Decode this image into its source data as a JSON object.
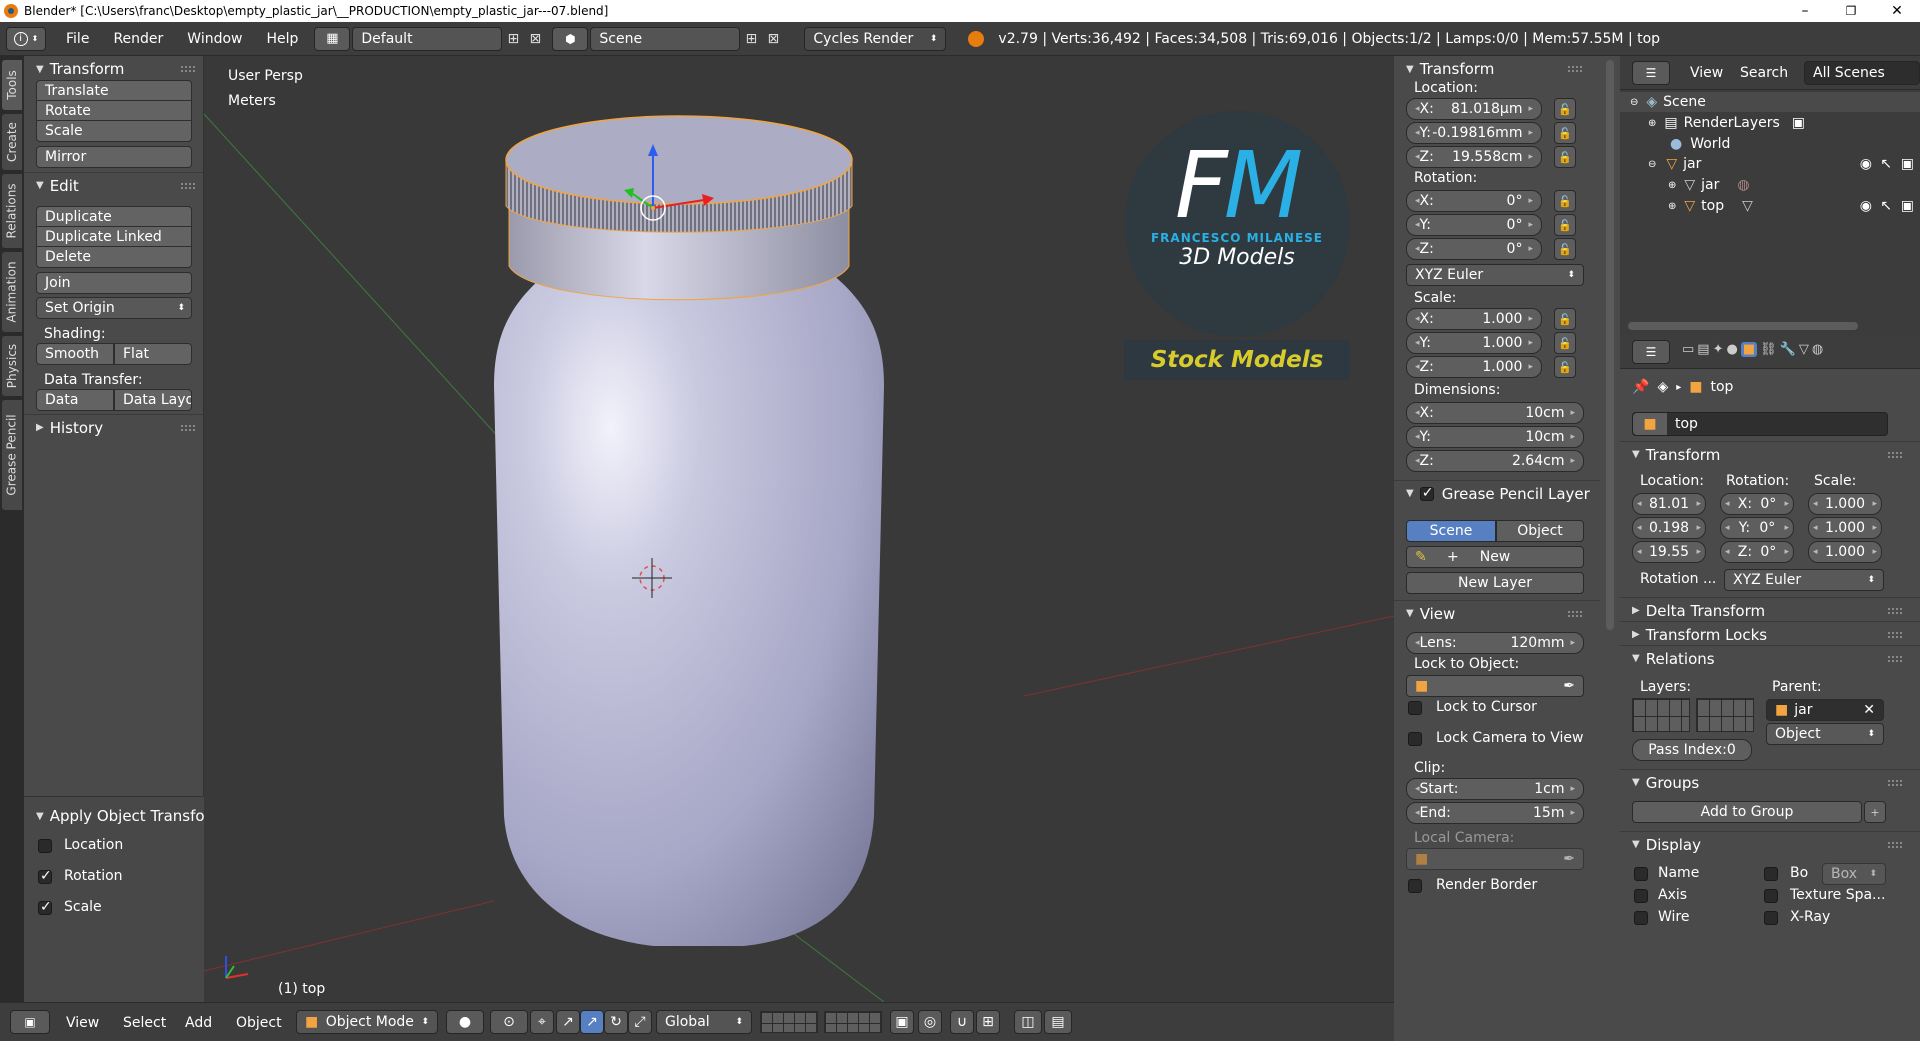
{
  "window": {
    "title": "Blender* [C:\\Users\\franc\\Desktop\\empty_plastic_jar\\__PRODUCTION\\empty_plastic_jar---07.blend]",
    "minimize": "–",
    "maximize": "❐",
    "close": "✕"
  },
  "menubar": {
    "info_icon": "i",
    "items": [
      "File",
      "Render",
      "Window",
      "Help"
    ],
    "screen_layout": "Default",
    "scene": "Scene",
    "render_engine": "Cycles Render",
    "stats": "v2.79 | Verts:36,492 | Faces:34,508 | Tris:69,016 | Objects:1/2 | Lamps:0/0 | Mem:57.55M | top"
  },
  "left_tabs": [
    "Tools",
    "Create",
    "Relations",
    "Animation",
    "Physics",
    "Grease Pencil"
  ],
  "toolshelf": {
    "transform": {
      "title": "Transform",
      "buttons": [
        "Translate",
        "Rotate",
        "Scale"
      ],
      "mirror": "Mirror"
    },
    "edit": {
      "title": "Edit",
      "buttons": [
        "Duplicate",
        "Duplicate Linked",
        "Delete"
      ],
      "join": "Join",
      "set_origin": "Set Origin",
      "shading_label": "Shading:",
      "smooth": "Smooth",
      "flat": "Flat",
      "data_transfer_label": "Data Transfer:",
      "data": "Data",
      "data_layout": "Data Layo"
    },
    "history": "History",
    "operator": {
      "title": "Apply Object Transform",
      "location": "Location",
      "location_checked": false,
      "rotation": "Rotation",
      "rotation_checked": true,
      "scale": "Scale",
      "scale_checked": true
    }
  },
  "viewport": {
    "view_name": "User Persp",
    "units": "Meters",
    "active_object": "(1) top",
    "logo": {
      "letters": "FM",
      "name": "FRANCESCO MILANESE",
      "sub": "3D Models",
      "badge": "Stock Models"
    }
  },
  "npanel": {
    "transform_title": "Transform",
    "location_label": "Location:",
    "location": {
      "x": "X:",
      "x_val": "81.018µm",
      "y": "Y:",
      "y_val": "-0.19816mm",
      "z": "Z:",
      "z_val": "19.558cm"
    },
    "rotation_label": "Rotation:",
    "rotation": {
      "x": "X:",
      "x_val": "0°",
      "y": "Y:",
      "y_val": "0°",
      "z": "Z:",
      "z_val": "0°"
    },
    "rotation_mode": "XYZ Euler",
    "scale_label": "Scale:",
    "scale": {
      "x": "X:",
      "x_val": "1.000",
      "y": "Y:",
      "y_val": "1.000",
      "z": "Z:",
      "z_val": "1.000"
    },
    "dimensions_label": "Dimensions:",
    "dimensions": {
      "x": "X:",
      "x_val": "10cm",
      "y": "Y:",
      "y_val": "10cm",
      "z": "Z:",
      "z_val": "2.64cm"
    },
    "grease_title": "Grease Pencil Layer",
    "scene_btn": "Scene",
    "object_btn": "Object",
    "new_btn": "New",
    "new_layer_btn": "New Layer",
    "view_title": "View",
    "lens_label": "Lens:",
    "lens_val": "120mm",
    "lock_object_label": "Lock to Object:",
    "lock_cursor": "Lock to Cursor",
    "lock_camera": "Lock Camera to View",
    "clip_label": "Clip:",
    "clip_start_label": "Start:",
    "clip_start": "1cm",
    "clip_end_label": "End:",
    "clip_end": "15m",
    "local_camera_label": "Local Camera:",
    "render_border": "Render Border"
  },
  "outliner": {
    "view": "View",
    "search": "Search",
    "filter": "All Scenes",
    "items": {
      "scene": "Scene",
      "renderlayers": "RenderLayers",
      "world": "World",
      "jar": "jar",
      "jar_mesh": "jar",
      "top": "top"
    }
  },
  "properties": {
    "breadcrumb": "top",
    "object_name": "top",
    "transform_title": "Transform",
    "location_label": "Location:",
    "rotation_label": "Rotation:",
    "scale_label": "Scale:",
    "loc": [
      "81.01",
      "0.198",
      "19.55"
    ],
    "rot_x": "X:",
    "rot_y": "Y:",
    "rot_z": "Z:",
    "rot": [
      "0°",
      "0°",
      "0°"
    ],
    "scale": [
      "1.000",
      "1.000",
      "1.000"
    ],
    "rotation_mode_label": "Rotation ...",
    "rotation_mode": "XYZ Euler",
    "delta_transform": "Delta Transform",
    "transform_locks": "Transform Locks",
    "relations_title": "Relations",
    "layers_label": "Layers:",
    "parent_label": "Parent:",
    "parent_value": "jar",
    "parent_type": "Object",
    "pass_index": "Pass Index:0",
    "groups_title": "Groups",
    "add_to_group": "Add to Group",
    "display_title": "Display",
    "display_name": "Name",
    "display_bounds": "Bo",
    "display_box": "Box",
    "display_axis": "Axis",
    "display_texture_space": "Texture Spa...",
    "display_wire": "Wire",
    "display_xray": "X-Ray"
  },
  "bottombar": {
    "view": "View",
    "select": "Select",
    "add": "Add",
    "object": "Object",
    "mode": "Object Mode",
    "orientation": "Global"
  },
  "colors": {
    "accent_blue": "#5680c2",
    "selection_orange": "#f1a440",
    "logo_cyan": "#2ab0e4",
    "logo_yellow": "#d8cc2c"
  }
}
